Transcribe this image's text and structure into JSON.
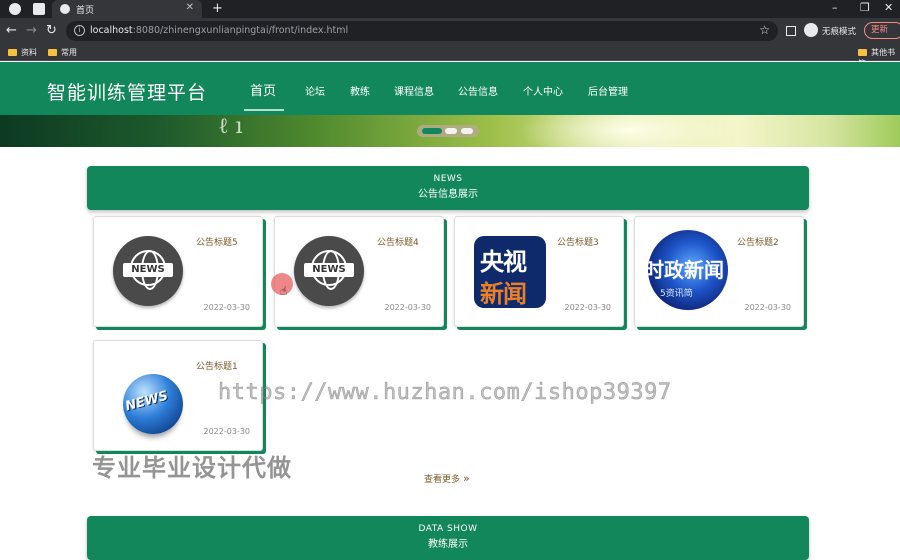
{
  "browser": {
    "tab_title": "首页",
    "url_host": "localhost",
    "url_rest": ":8080/zhinengxunlianpingtai/front/index.html",
    "incognito_label": "无痕模式",
    "update_label": "更新",
    "bookmarks": [
      {
        "label": "资料"
      },
      {
        "label": "常用"
      }
    ],
    "other_bookmarks": "其他书签"
  },
  "site": {
    "logo": "智能训练管理平台",
    "nav": [
      {
        "label": "首页",
        "active": true
      },
      {
        "label": "论坛"
      },
      {
        "label": "教练"
      },
      {
        "label": "课程信息"
      },
      {
        "label": "公告信息"
      },
      {
        "label": "个人中心"
      },
      {
        "label": "后台管理"
      }
    ]
  },
  "news_section": {
    "en": "NEWS",
    "zh": "公告信息展示",
    "cards": [
      {
        "title": "公告标题5",
        "date": "2022-03-30",
        "image": "news-badge-icon"
      },
      {
        "title": "公告标题4",
        "date": "2022-03-30",
        "image": "news-badge-icon"
      },
      {
        "title": "公告标题3",
        "date": "2022-03-30",
        "image": "cctv-news-logo",
        "logo_l1": "央视",
        "logo_l2": "新闻"
      },
      {
        "title": "公告标题2",
        "date": "2022-03-30",
        "image": "shizheng-news-logo",
        "logo_text": "时政新闻",
        "logo_sub": "5资讯简"
      },
      {
        "title": "公告标题1",
        "date": "2022-03-30",
        "image": "globe-news-icon",
        "logo_text": "NEWS"
      }
    ],
    "more": "查看更多"
  },
  "watermark": "https://www.huzhan.com/ishop39397",
  "promo": "专业毕业设计代做",
  "data_section": {
    "en": "DATA SHOW",
    "zh": "教练展示"
  }
}
